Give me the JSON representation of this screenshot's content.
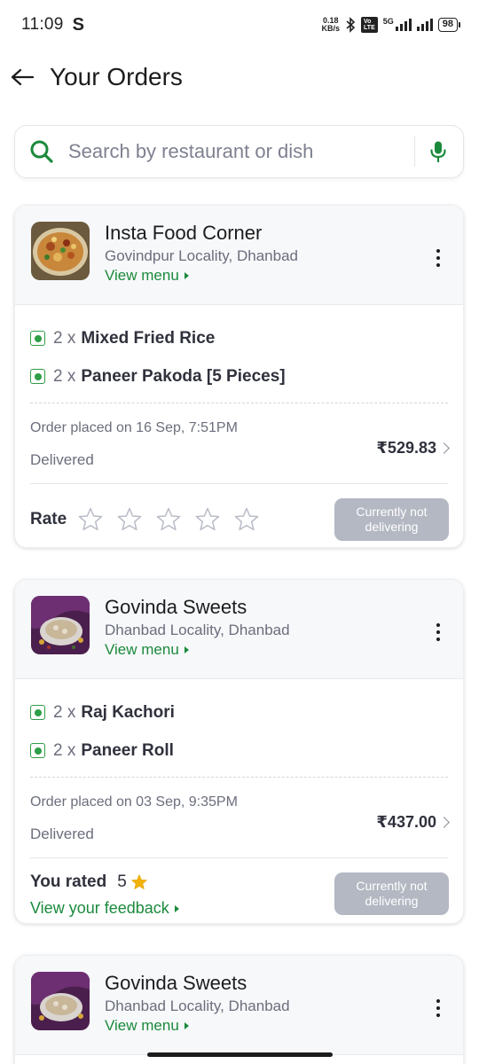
{
  "status_bar": {
    "time": "11:09",
    "app_badge": "S",
    "net_speed_value": "0.18",
    "net_speed_unit": "KB/s",
    "network": "5G",
    "battery": "98"
  },
  "header": {
    "title": "Your Orders"
  },
  "search": {
    "placeholder": "Search by restaurant or dish"
  },
  "accent_color": "#1b8a3c",
  "orders": [
    {
      "restaurant": "Insta Food Corner",
      "locality": "Govindpur Locality, Dhanbad",
      "view_menu": "View menu",
      "items": [
        {
          "qty": "2 x",
          "name": "Mixed Fried Rice"
        },
        {
          "qty": "2 x",
          "name": "Paneer Pakoda [5 Pieces]"
        }
      ],
      "placed_on": "Order placed on 16 Sep, 7:51PM",
      "status": "Delivered",
      "price": "₹529.83",
      "rate_label": "Rate",
      "stars_total": 5,
      "delivery_badge": "Currently not delivering"
    },
    {
      "restaurant": "Govinda Sweets",
      "locality": "Dhanbad Locality, Dhanbad",
      "view_menu": "View menu",
      "items": [
        {
          "qty": "2 x",
          "name": "Raj Kachori"
        },
        {
          "qty": "2 x",
          "name": "Paneer Roll"
        }
      ],
      "placed_on": "Order placed on 03 Sep, 9:35PM",
      "status": "Delivered",
      "price": "₹437.00",
      "rated_label": "You rated",
      "rated_value": "5",
      "feedback_link": "View your feedback",
      "delivery_badge": "Currently not delivering"
    },
    {
      "restaurant": "Govinda Sweets",
      "locality": "Dhanbad Locality, Dhanbad",
      "view_menu": "View menu"
    }
  ]
}
